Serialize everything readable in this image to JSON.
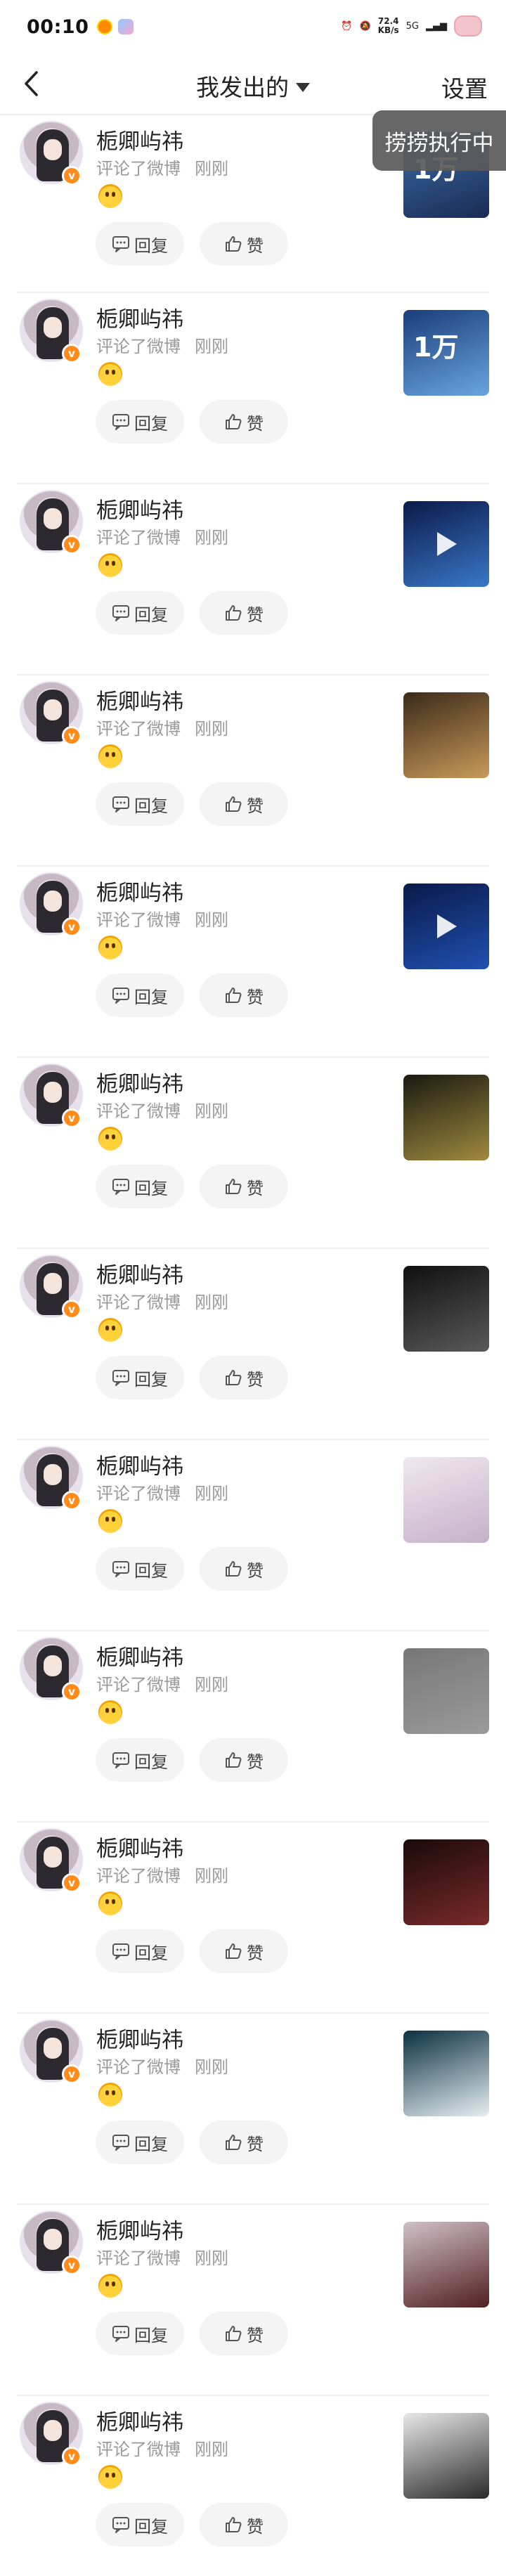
{
  "status_bar": {
    "time": "00:10",
    "net_speed": "72.4",
    "net_unit": "KB/s",
    "signal": "5G"
  },
  "header": {
    "title": "我发出的",
    "settings_label": "设置",
    "toast": "捞捞执行中"
  },
  "colors": {
    "verified_badge": "#ff8c1a",
    "action_bg": "#f4f4f4",
    "meta_text": "#9a9a9a"
  },
  "comments": [
    {
      "user": "栀卿屿祎",
      "action": "评论了微博",
      "time": "刚刚",
      "emoji": "emoji-face",
      "reply_label": "回复",
      "like_label": "赞",
      "thumb_text": "1万",
      "has_play": false
    },
    {
      "user": "栀卿屿祎",
      "action": "评论了微博",
      "time": "刚刚",
      "emoji": "emoji-face",
      "reply_label": "回复",
      "like_label": "赞",
      "thumb_text": "1万",
      "has_play": false
    },
    {
      "user": "栀卿屿祎",
      "action": "评论了微博",
      "time": "刚刚",
      "emoji": "emoji-face",
      "reply_label": "回复",
      "like_label": "赞",
      "thumb_text": "",
      "has_play": true
    },
    {
      "user": "栀卿屿祎",
      "action": "评论了微博",
      "time": "刚刚",
      "emoji": "emoji-face",
      "reply_label": "回复",
      "like_label": "赞",
      "thumb_text": "",
      "has_play": false
    },
    {
      "user": "栀卿屿祎",
      "action": "评论了微博",
      "time": "刚刚",
      "emoji": "emoji-face",
      "reply_label": "回复",
      "like_label": "赞",
      "thumb_text": "",
      "has_play": true
    },
    {
      "user": "栀卿屿祎",
      "action": "评论了微博",
      "time": "刚刚",
      "emoji": "emoji-face",
      "reply_label": "回复",
      "like_label": "赞",
      "thumb_text": "",
      "has_play": false
    },
    {
      "user": "栀卿屿祎",
      "action": "评论了微博",
      "time": "刚刚",
      "emoji": "emoji-face",
      "reply_label": "回复",
      "like_label": "赞",
      "thumb_text": "",
      "has_play": false
    },
    {
      "user": "栀卿屿祎",
      "action": "评论了微博",
      "time": "刚刚",
      "emoji": "emoji-face",
      "reply_label": "回复",
      "like_label": "赞",
      "thumb_text": "",
      "has_play": false
    },
    {
      "user": "栀卿屿祎",
      "action": "评论了微博",
      "time": "刚刚",
      "emoji": "emoji-face",
      "reply_label": "回复",
      "like_label": "赞",
      "thumb_text": "",
      "has_play": false
    },
    {
      "user": "栀卿屿祎",
      "action": "评论了微博",
      "time": "刚刚",
      "emoji": "emoji-face",
      "reply_label": "回复",
      "like_label": "赞",
      "thumb_text": "",
      "has_play": false
    },
    {
      "user": "栀卿屿祎",
      "action": "评论了微博",
      "time": "刚刚",
      "emoji": "emoji-face",
      "reply_label": "回复",
      "like_label": "赞",
      "thumb_text": "",
      "has_play": false
    },
    {
      "user": "栀卿屿祎",
      "action": "评论了微博",
      "time": "刚刚",
      "emoji": "emoji-face",
      "reply_label": "回复",
      "like_label": "赞",
      "thumb_text": "",
      "has_play": false
    },
    {
      "user": "栀卿屿祎",
      "action": "评论了微博",
      "time": "刚刚",
      "emoji": "emoji-face",
      "reply_label": "回复",
      "like_label": "赞",
      "thumb_text": "",
      "has_play": false
    }
  ]
}
